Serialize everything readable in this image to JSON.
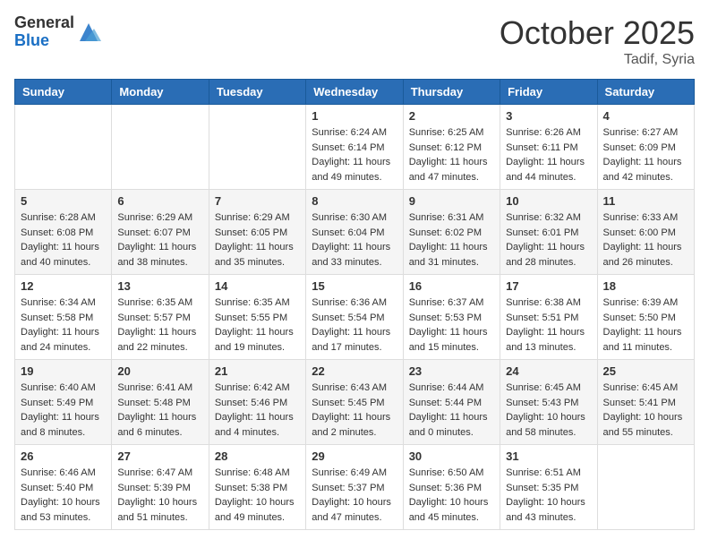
{
  "header": {
    "logo_general": "General",
    "logo_blue": "Blue",
    "month": "October 2025",
    "location": "Tadif, Syria"
  },
  "weekdays": [
    "Sunday",
    "Monday",
    "Tuesday",
    "Wednesday",
    "Thursday",
    "Friday",
    "Saturday"
  ],
  "weeks": [
    [
      {
        "day": "",
        "info": ""
      },
      {
        "day": "",
        "info": ""
      },
      {
        "day": "",
        "info": ""
      },
      {
        "day": "1",
        "info": "Sunrise: 6:24 AM\nSunset: 6:14 PM\nDaylight: 11 hours and 49 minutes."
      },
      {
        "day": "2",
        "info": "Sunrise: 6:25 AM\nSunset: 6:12 PM\nDaylight: 11 hours and 47 minutes."
      },
      {
        "day": "3",
        "info": "Sunrise: 6:26 AM\nSunset: 6:11 PM\nDaylight: 11 hours and 44 minutes."
      },
      {
        "day": "4",
        "info": "Sunrise: 6:27 AM\nSunset: 6:09 PM\nDaylight: 11 hours and 42 minutes."
      }
    ],
    [
      {
        "day": "5",
        "info": "Sunrise: 6:28 AM\nSunset: 6:08 PM\nDaylight: 11 hours and 40 minutes."
      },
      {
        "day": "6",
        "info": "Sunrise: 6:29 AM\nSunset: 6:07 PM\nDaylight: 11 hours and 38 minutes."
      },
      {
        "day": "7",
        "info": "Sunrise: 6:29 AM\nSunset: 6:05 PM\nDaylight: 11 hours and 35 minutes."
      },
      {
        "day": "8",
        "info": "Sunrise: 6:30 AM\nSunset: 6:04 PM\nDaylight: 11 hours and 33 minutes."
      },
      {
        "day": "9",
        "info": "Sunrise: 6:31 AM\nSunset: 6:02 PM\nDaylight: 11 hours and 31 minutes."
      },
      {
        "day": "10",
        "info": "Sunrise: 6:32 AM\nSunset: 6:01 PM\nDaylight: 11 hours and 28 minutes."
      },
      {
        "day": "11",
        "info": "Sunrise: 6:33 AM\nSunset: 6:00 PM\nDaylight: 11 hours and 26 minutes."
      }
    ],
    [
      {
        "day": "12",
        "info": "Sunrise: 6:34 AM\nSunset: 5:58 PM\nDaylight: 11 hours and 24 minutes."
      },
      {
        "day": "13",
        "info": "Sunrise: 6:35 AM\nSunset: 5:57 PM\nDaylight: 11 hours and 22 minutes."
      },
      {
        "day": "14",
        "info": "Sunrise: 6:35 AM\nSunset: 5:55 PM\nDaylight: 11 hours and 19 minutes."
      },
      {
        "day": "15",
        "info": "Sunrise: 6:36 AM\nSunset: 5:54 PM\nDaylight: 11 hours and 17 minutes."
      },
      {
        "day": "16",
        "info": "Sunrise: 6:37 AM\nSunset: 5:53 PM\nDaylight: 11 hours and 15 minutes."
      },
      {
        "day": "17",
        "info": "Sunrise: 6:38 AM\nSunset: 5:51 PM\nDaylight: 11 hours and 13 minutes."
      },
      {
        "day": "18",
        "info": "Sunrise: 6:39 AM\nSunset: 5:50 PM\nDaylight: 11 hours and 11 minutes."
      }
    ],
    [
      {
        "day": "19",
        "info": "Sunrise: 6:40 AM\nSunset: 5:49 PM\nDaylight: 11 hours and 8 minutes."
      },
      {
        "day": "20",
        "info": "Sunrise: 6:41 AM\nSunset: 5:48 PM\nDaylight: 11 hours and 6 minutes."
      },
      {
        "day": "21",
        "info": "Sunrise: 6:42 AM\nSunset: 5:46 PM\nDaylight: 11 hours and 4 minutes."
      },
      {
        "day": "22",
        "info": "Sunrise: 6:43 AM\nSunset: 5:45 PM\nDaylight: 11 hours and 2 minutes."
      },
      {
        "day": "23",
        "info": "Sunrise: 6:44 AM\nSunset: 5:44 PM\nDaylight: 11 hours and 0 minutes."
      },
      {
        "day": "24",
        "info": "Sunrise: 6:45 AM\nSunset: 5:43 PM\nDaylight: 10 hours and 58 minutes."
      },
      {
        "day": "25",
        "info": "Sunrise: 6:45 AM\nSunset: 5:41 PM\nDaylight: 10 hours and 55 minutes."
      }
    ],
    [
      {
        "day": "26",
        "info": "Sunrise: 6:46 AM\nSunset: 5:40 PM\nDaylight: 10 hours and 53 minutes."
      },
      {
        "day": "27",
        "info": "Sunrise: 6:47 AM\nSunset: 5:39 PM\nDaylight: 10 hours and 51 minutes."
      },
      {
        "day": "28",
        "info": "Sunrise: 6:48 AM\nSunset: 5:38 PM\nDaylight: 10 hours and 49 minutes."
      },
      {
        "day": "29",
        "info": "Sunrise: 6:49 AM\nSunset: 5:37 PM\nDaylight: 10 hours and 47 minutes."
      },
      {
        "day": "30",
        "info": "Sunrise: 6:50 AM\nSunset: 5:36 PM\nDaylight: 10 hours and 45 minutes."
      },
      {
        "day": "31",
        "info": "Sunrise: 6:51 AM\nSunset: 5:35 PM\nDaylight: 10 hours and 43 minutes."
      },
      {
        "day": "",
        "info": ""
      }
    ]
  ]
}
